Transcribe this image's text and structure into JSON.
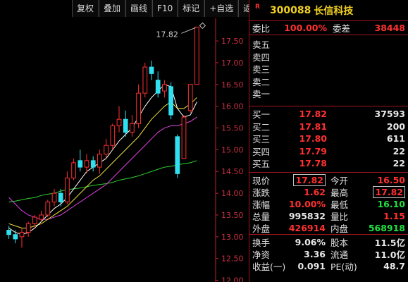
{
  "toolbar": {
    "buttons": [
      "复权",
      "叠加",
      "画线",
      "F10",
      "标记",
      "+自选",
      "返回"
    ]
  },
  "chart": {
    "high_label": "17.82",
    "y_ticks": [
      "17.50",
      "17.00",
      "16.50",
      "16.00",
      "15.50",
      "15.00",
      "14.50",
      "14.00",
      "13.50",
      "13.00",
      "12.50",
      "12.00"
    ],
    "colors": {
      "up": "#ff3030",
      "down": "#30e0f0",
      "ma5": "#ffffff",
      "ma10": "#f0e040",
      "ma20": "#e040e0",
      "ma60": "#30d030",
      "axis": "#c02030"
    }
  },
  "chart_data": {
    "type": "candlestick",
    "ylim": [
      12.0,
      17.75
    ],
    "candles": [
      {
        "o": 13.15,
        "h": 13.25,
        "l": 12.95,
        "c": 13.05
      },
      {
        "o": 13.05,
        "h": 13.15,
        "l": 12.85,
        "c": 12.95
      },
      {
        "o": 13.0,
        "h": 13.2,
        "l": 12.75,
        "c": 13.1
      },
      {
        "o": 13.1,
        "h": 13.35,
        "l": 13.0,
        "c": 13.3
      },
      {
        "o": 13.3,
        "h": 13.5,
        "l": 13.2,
        "c": 13.45
      },
      {
        "o": 13.4,
        "h": 13.6,
        "l": 13.35,
        "c": 13.5
      },
      {
        "o": 13.5,
        "h": 13.85,
        "l": 13.45,
        "c": 13.8
      },
      {
        "o": 13.8,
        "h": 14.1,
        "l": 13.7,
        "c": 14.0
      },
      {
        "o": 14.0,
        "h": 14.1,
        "l": 13.7,
        "c": 13.8
      },
      {
        "o": 13.8,
        "h": 14.5,
        "l": 13.75,
        "c": 14.35
      },
      {
        "o": 14.35,
        "h": 14.8,
        "l": 14.3,
        "c": 14.7
      },
      {
        "o": 14.75,
        "h": 15.0,
        "l": 14.5,
        "c": 14.6
      },
      {
        "o": 14.6,
        "h": 14.9,
        "l": 14.45,
        "c": 14.75
      },
      {
        "o": 14.75,
        "h": 14.85,
        "l": 14.5,
        "c": 14.6
      },
      {
        "o": 14.6,
        "h": 15.0,
        "l": 14.45,
        "c": 14.9
      },
      {
        "o": 14.9,
        "h": 15.25,
        "l": 14.8,
        "c": 15.1
      },
      {
        "o": 15.1,
        "h": 15.6,
        "l": 15.0,
        "c": 15.55
      },
      {
        "o": 15.55,
        "h": 16.0,
        "l": 15.4,
        "c": 15.7
      },
      {
        "o": 15.7,
        "h": 15.9,
        "l": 15.3,
        "c": 15.4
      },
      {
        "o": 15.4,
        "h": 15.8,
        "l": 15.3,
        "c": 15.6
      },
      {
        "o": 15.6,
        "h": 16.5,
        "l": 15.5,
        "c": 16.3
      },
      {
        "o": 16.3,
        "h": 17.0,
        "l": 16.2,
        "c": 16.9
      },
      {
        "o": 16.9,
        "h": 17.05,
        "l": 16.6,
        "c": 16.75
      },
      {
        "o": 16.6,
        "h": 16.8,
        "l": 16.2,
        "c": 16.3
      },
      {
        "o": 16.35,
        "h": 16.6,
        "l": 16.2,
        "c": 16.5
      },
      {
        "o": 16.45,
        "h": 16.55,
        "l": 15.7,
        "c": 15.8
      },
      {
        "o": 15.3,
        "h": 15.35,
        "l": 14.35,
        "c": 14.45
      },
      {
        "o": 14.8,
        "h": 15.8,
        "l": 14.8,
        "c": 15.75
      },
      {
        "o": 15.9,
        "h": 16.5,
        "l": 15.85,
        "c": 16.5
      },
      {
        "o": 16.5,
        "h": 17.82,
        "l": 16.5,
        "c": 17.82
      }
    ],
    "ma5": [
      13.2,
      13.1,
      13.05,
      13.1,
      13.2,
      13.35,
      13.5,
      13.65,
      13.75,
      13.9,
      14.1,
      14.3,
      14.5,
      14.6,
      14.7,
      14.8,
      15.0,
      15.2,
      15.35,
      15.5,
      15.75,
      16.0,
      16.2,
      16.35,
      16.5,
      16.45,
      15.95,
      15.75,
      15.8,
      16.1
    ],
    "ma10": [
      13.3,
      13.25,
      13.2,
      13.2,
      13.25,
      13.3,
      13.4,
      13.5,
      13.6,
      13.7,
      13.85,
      14.0,
      14.15,
      14.3,
      14.4,
      14.55,
      14.7,
      14.85,
      15.0,
      15.15,
      15.3,
      15.5,
      15.7,
      15.85,
      16.0,
      16.1,
      15.95,
      15.95,
      16.05,
      16.2
    ],
    "ma20": [
      13.9,
      13.75,
      13.6,
      13.5,
      13.45,
      13.4,
      13.4,
      13.45,
      13.5,
      13.6,
      13.7,
      13.8,
      13.9,
      14.0,
      14.1,
      14.2,
      14.35,
      14.5,
      14.65,
      14.8,
      14.95,
      15.1,
      15.25,
      15.4,
      15.5,
      15.55,
      15.55,
      15.6,
      15.65,
      15.75
    ],
    "ma60": [
      13.8,
      13.82,
      13.85,
      13.88,
      13.9,
      13.95,
      13.98,
      14.0,
      14.05,
      14.08,
      14.1,
      14.12,
      14.15,
      14.18,
      14.2,
      14.22,
      14.25,
      14.3,
      14.33,
      14.36,
      14.4,
      14.45,
      14.5,
      14.55,
      14.6,
      14.62,
      14.65,
      14.68,
      14.7,
      14.75
    ]
  },
  "panel": {
    "r_badge": "R",
    "code": "300088",
    "name": "长信科技",
    "weibi_label": "委比",
    "weibi_value": "100.00%",
    "weicha_label": "委差",
    "weicha_value": "38448",
    "sells": [
      {
        "label": "卖五",
        "price": "",
        "vol": ""
      },
      {
        "label": "卖四",
        "price": "",
        "vol": ""
      },
      {
        "label": "卖三",
        "price": "",
        "vol": ""
      },
      {
        "label": "卖二",
        "price": "",
        "vol": ""
      },
      {
        "label": "卖一",
        "price": "",
        "vol": ""
      }
    ],
    "buys": [
      {
        "label": "买一",
        "price": "17.82",
        "vol": "37593"
      },
      {
        "label": "买二",
        "price": "17.81",
        "vol": "200"
      },
      {
        "label": "买三",
        "price": "17.80",
        "vol": "611"
      },
      {
        "label": "买四",
        "price": "17.79",
        "vol": "22"
      },
      {
        "label": "买五",
        "price": "17.78",
        "vol": "22"
      }
    ],
    "stats": [
      {
        "l1": "现价",
        "v1": "17.82",
        "l2": "今开",
        "v2": "16.50",
        "c1": "red",
        "c2": "red",
        "b1": true,
        "b2": false
      },
      {
        "l1": "涨跌",
        "v1": "1.62",
        "l2": "最高",
        "v2": "17.82",
        "c1": "red",
        "c2": "red",
        "b1": false,
        "b2": true
      },
      {
        "l1": "涨幅",
        "v1": "10.00%",
        "l2": "最低",
        "v2": "16.10",
        "c1": "red",
        "c2": "green",
        "b1": false,
        "b2": false
      },
      {
        "l1": "总量",
        "v1": "995832",
        "l2": "量比",
        "v2": "1.15",
        "c1": "white",
        "c2": "red",
        "b1": false,
        "b2": false
      },
      {
        "l1": "外盘",
        "v1": "426914",
        "l2": "内盘",
        "v2": "568918",
        "c1": "red",
        "c2": "green",
        "b1": false,
        "b2": false
      }
    ],
    "stats2": [
      {
        "l1": "换手",
        "v1": "9.06%",
        "l2": "股本",
        "v2": "11.5亿",
        "c1": "white",
        "c2": "white"
      },
      {
        "l1": "净资",
        "v1": "3.36",
        "l2": "流通",
        "v2": "11.0亿",
        "c1": "white",
        "c2": "white"
      },
      {
        "l1": "收益(一)",
        "v1": "0.091",
        "l2": "PE(动)",
        "v2": "48.7",
        "c1": "white",
        "c2": "white"
      }
    ]
  }
}
